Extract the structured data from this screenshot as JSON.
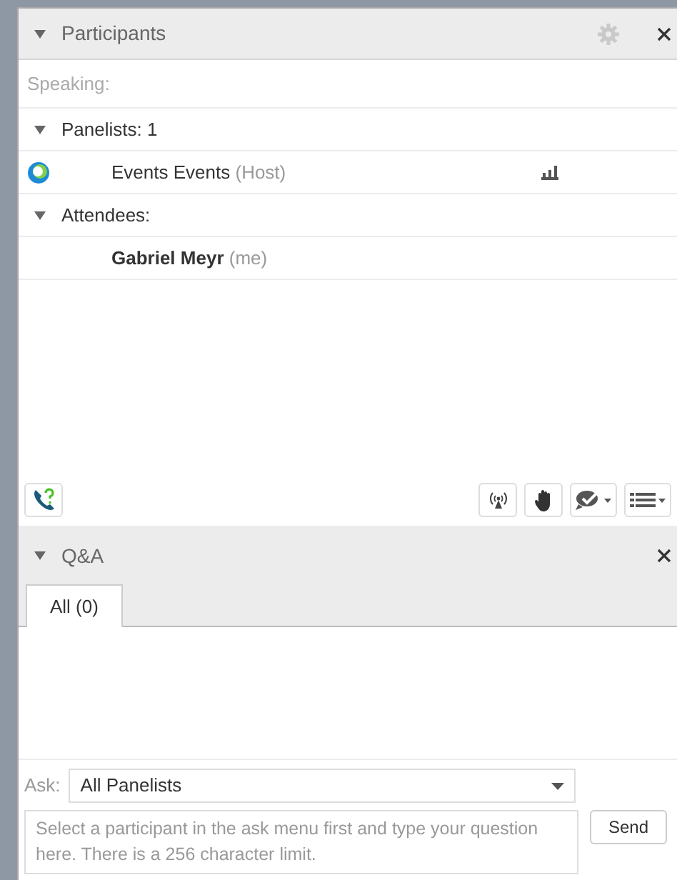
{
  "participants": {
    "title": "Participants",
    "speaking_label": "Speaking:",
    "groups": [
      {
        "label": "Panelists: 1",
        "expanded": true,
        "members": [
          {
            "name": "Events Events",
            "tag": "(Host)",
            "current_user": false,
            "status_icon": true,
            "signal_icon": true
          }
        ]
      },
      {
        "label": "Attendees:",
        "expanded": true,
        "members": [
          {
            "name": "Gabriel Meyr",
            "tag": "(me)",
            "current_user": true,
            "status_icon": false,
            "signal_icon": false
          }
        ]
      }
    ]
  },
  "qa": {
    "title": "Q&A",
    "expanded": true,
    "tabs": [
      {
        "label": "All (0)",
        "selected": true
      }
    ],
    "ask_label": "Ask:",
    "ask_value": "All Panelists",
    "question": {
      "placeholder": "Select a participant in the ask menu first and type your question here. There is a 256 character limit."
    },
    "send": "Send"
  }
}
